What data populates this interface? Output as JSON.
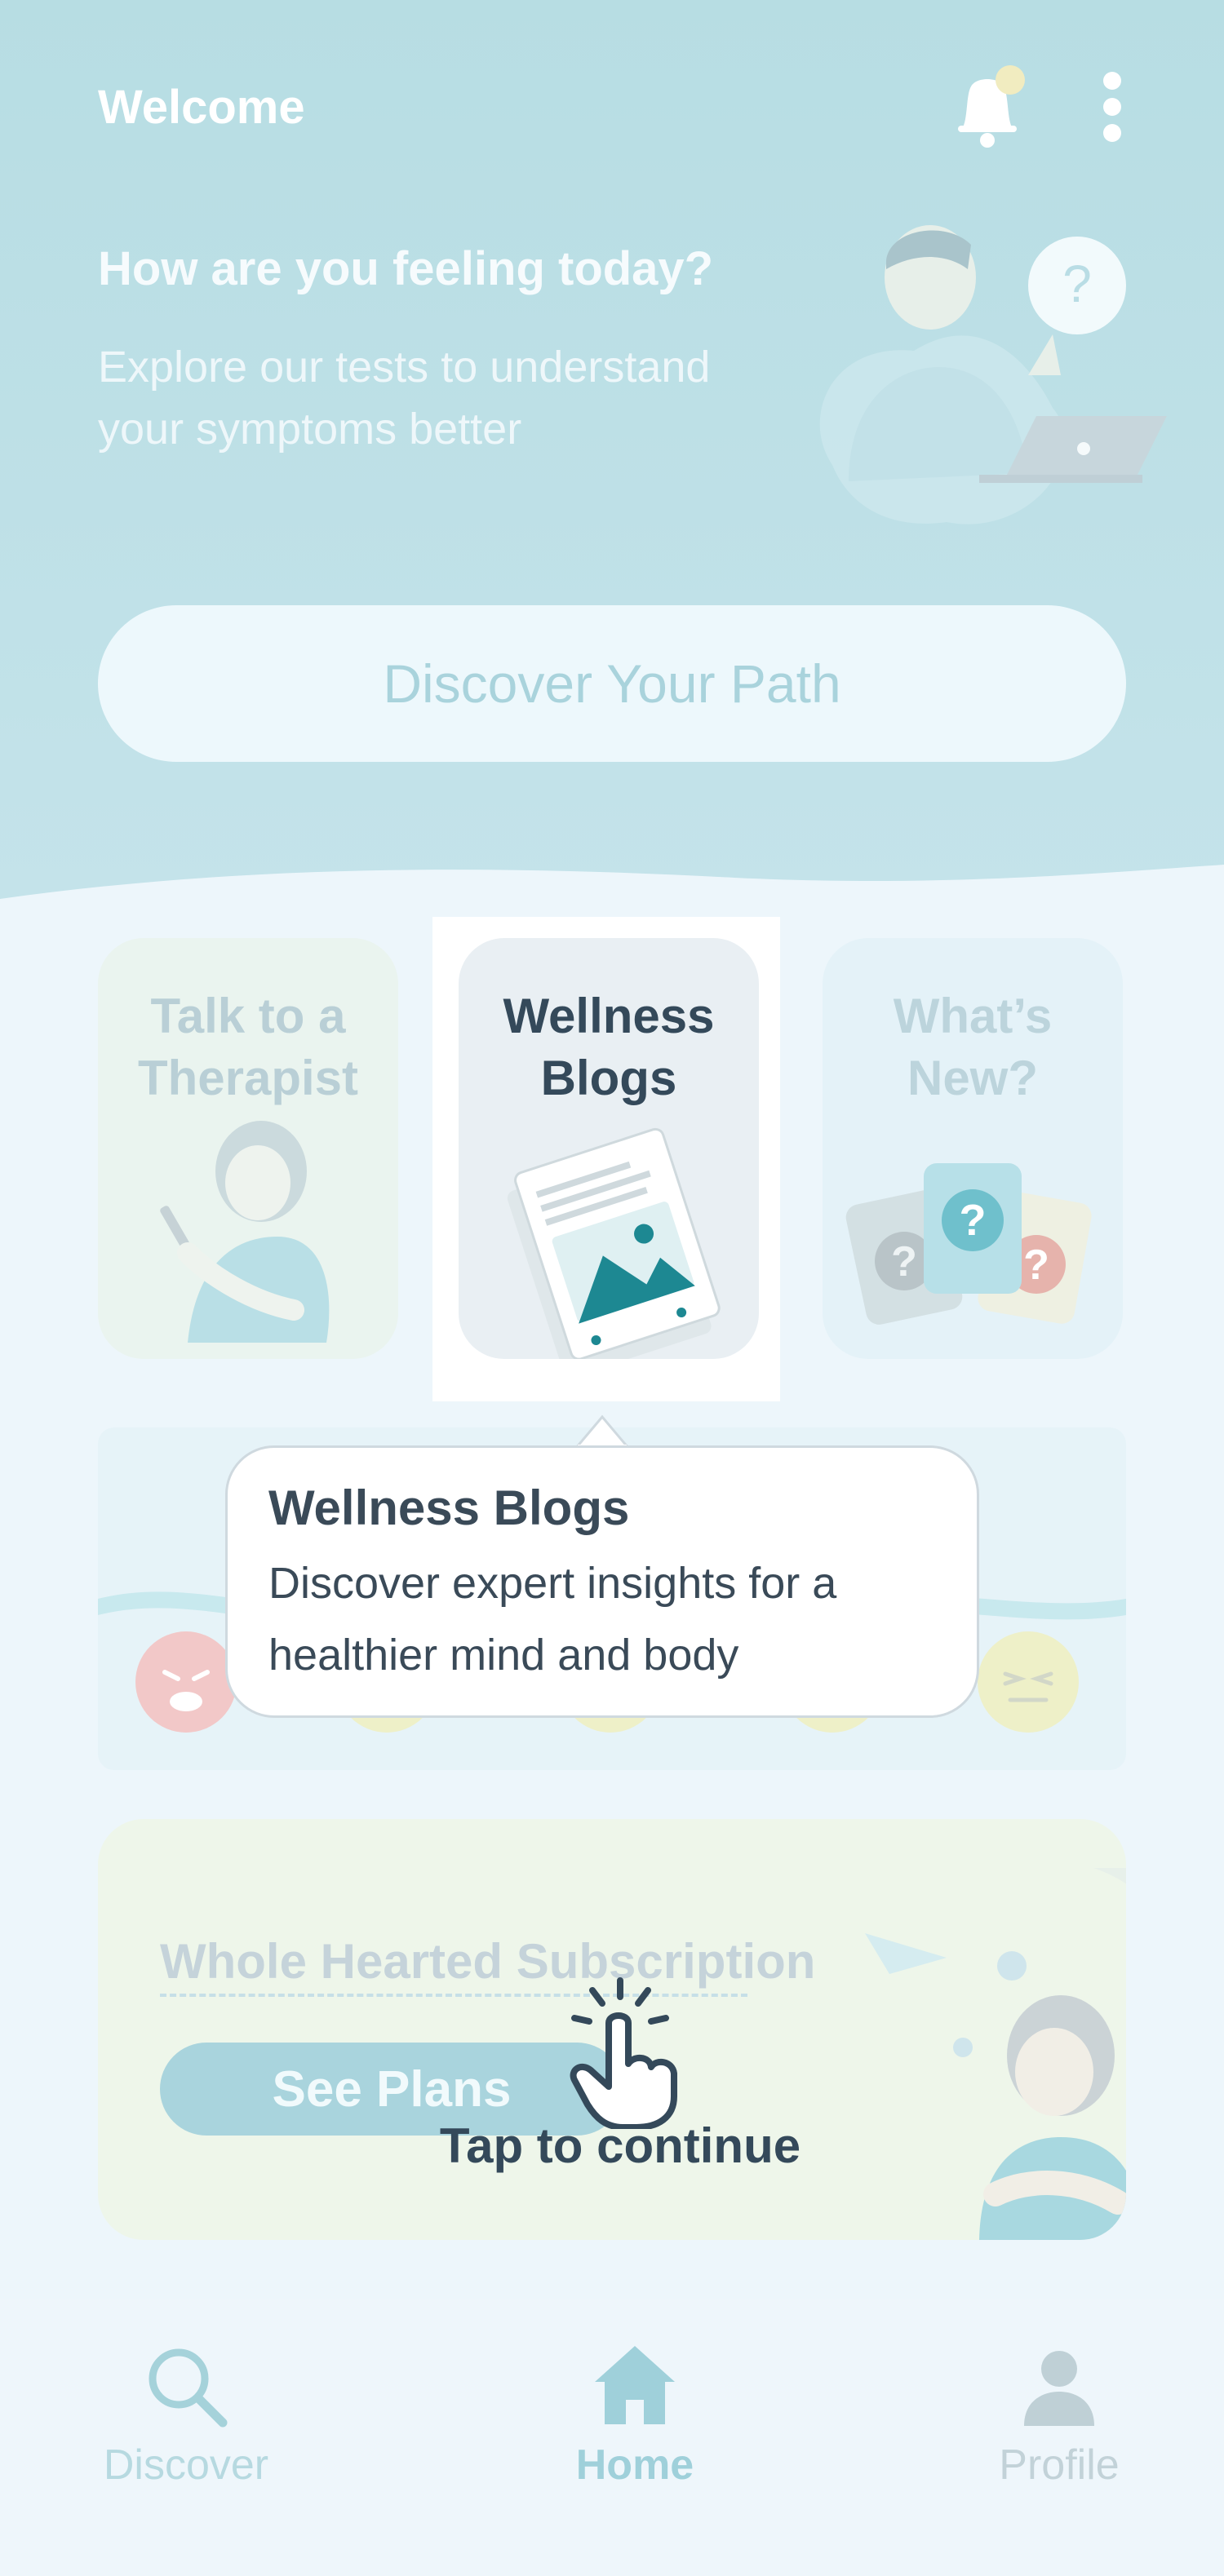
{
  "header": {
    "welcome": "Welcome",
    "feeling_title": "How are you feeling today?",
    "explore_text": "Explore our tests to understand your symptoms better",
    "discover_button": "Discover Your Path"
  },
  "cards": [
    {
      "title": "Talk to a Therapist"
    },
    {
      "title": "Wellness Blogs"
    },
    {
      "title": "What’s New?"
    }
  ],
  "tooltip": {
    "title": "Wellness Blogs",
    "body": "Discover expert insights for a healthier mind and body"
  },
  "subscription": {
    "title": "Whole Hearted Subscription",
    "button": "See Plans"
  },
  "hint": {
    "text": "Tap to continue"
  },
  "bottom_nav": [
    {
      "label": "Discover",
      "icon": "search-icon",
      "active": false
    },
    {
      "label": "Home",
      "icon": "home-icon",
      "active": true
    },
    {
      "label": "Profile",
      "icon": "person-icon",
      "active": false
    }
  ],
  "colors": {
    "header_bg": "#b7dde3",
    "page_bg": "#edf6fb",
    "accent": "#9fd0da",
    "text_dark": "#34495a"
  }
}
